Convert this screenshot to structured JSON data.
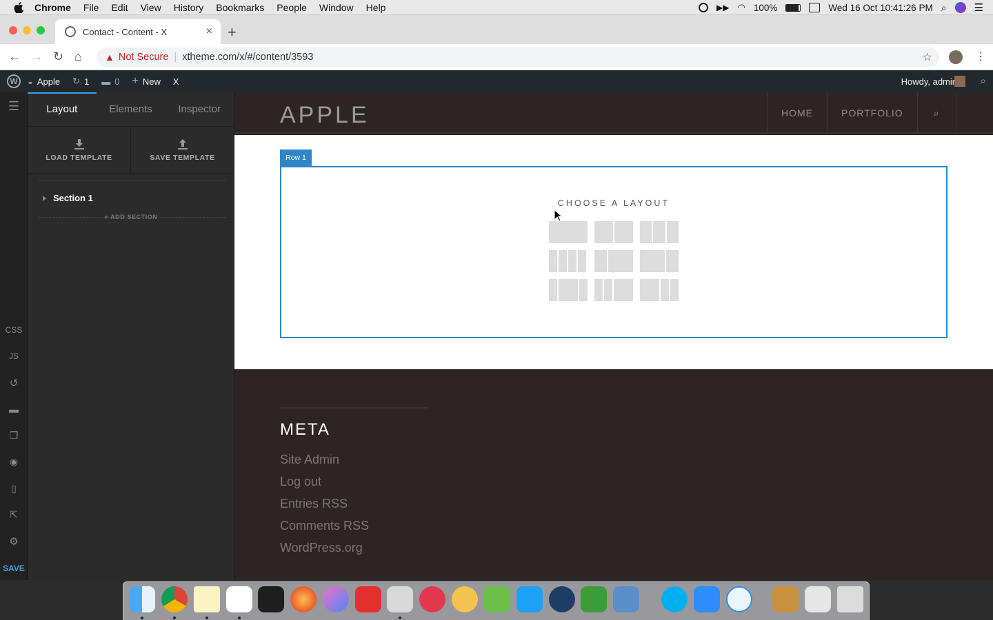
{
  "menubar": {
    "app": "Chrome",
    "items": [
      "File",
      "Edit",
      "View",
      "History",
      "Bookmarks",
      "People",
      "Window",
      "Help"
    ],
    "battery": "100%",
    "datetime": "Wed 16 Oct  10:41:26 PM"
  },
  "browser": {
    "tab_title": "Contact - Content - X",
    "tab_close": "×",
    "new_tab": "+",
    "not_secure": "Not Secure",
    "url": "xtheme.com/x/#/content/3593"
  },
  "wp_admin_bar": {
    "site": "Apple",
    "updates": "1",
    "comments": "0",
    "new": "New",
    "x": "X",
    "howdy": "Howdy, admin"
  },
  "rail": {
    "css": "CSS",
    "js": "JS",
    "save": "SAVE"
  },
  "panel": {
    "tabs": [
      "Layout",
      "Elements",
      "Inspector"
    ],
    "load_template": "LOAD TEMPLATE",
    "save_template": "SAVE TEMPLATE",
    "section": "Section 1",
    "add_section": "+ ADD SECTION"
  },
  "site": {
    "logo": "APPLE",
    "nav": [
      "HOME",
      "PORTFOLIO"
    ],
    "row_label": "Row 1",
    "choose_layout": "CHOOSE A LAYOUT",
    "footer_heading": "META",
    "footer_links": [
      "Site Admin",
      "Log out",
      "Entries RSS",
      "Comments RSS",
      "WordPress.org"
    ]
  },
  "dock_apps": [
    "Finder",
    "Chrome",
    "Notes",
    "Slack",
    "Terminal",
    "Firefox",
    "iTunes",
    "XMind",
    "Sequel Pro",
    "Airmail",
    "Atom",
    "Feedly",
    "Twitter",
    "QuickTime",
    "Coda",
    "Sublime",
    "Skype",
    "Zoom",
    "Safari",
    "Archive",
    "Chrome Apps",
    "Trash"
  ]
}
